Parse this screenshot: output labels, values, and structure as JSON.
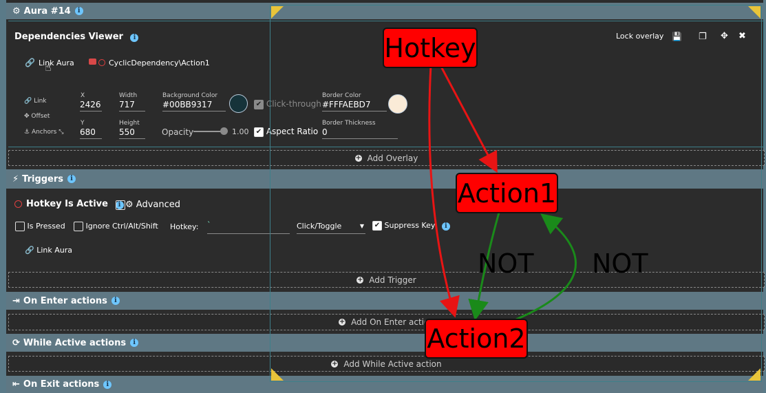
{
  "aura_header": {
    "title": "Aura #14"
  },
  "dependencies": {
    "title": "Dependencies Viewer",
    "lock_overlay": "Lock overlay"
  },
  "link_row": {
    "link_aura": "Link Aura",
    "path": "CyclicDependency\\Action1"
  },
  "props": {
    "side_link": "Link",
    "side_offset": "Offset",
    "side_anchors": "Anchors",
    "x_label": "X",
    "x_value": "2426",
    "y_label": "Y",
    "y_value": "680",
    "width_label": "Width",
    "width_value": "717",
    "height_label": "Height",
    "height_value": "550",
    "bg_color_label": "Background Color",
    "bg_color_value": "#00BB9317",
    "click_through": "Click-through",
    "opacity_label": "Opacity",
    "opacity_value": "1.00",
    "opacity_fraction": 1.0,
    "aspect_ratio": "Aspect Ratio",
    "border_color_label": "Border Color",
    "border_color_value": "#FFFAEBD7",
    "border_thickness_label": "Border Thickness",
    "border_thickness_value": "0"
  },
  "add_overlay": "Add Overlay",
  "triggers": {
    "title": "Triggers",
    "hotkey_active": "Hotkey Is Active",
    "advanced": "Advanced",
    "is_pressed": "Is Pressed",
    "ignore": "Ignore Ctrl/Alt/Shift",
    "hotkey_label": "Hotkey:",
    "hotkey_value": "`",
    "mode": "Click/Toggle",
    "suppress": "Suppress Key",
    "link_aura": "Link Aura",
    "add_trigger": "Add Trigger"
  },
  "on_enter": {
    "title": "On Enter actions",
    "add": "Add On Enter action"
  },
  "while_active": {
    "title": "While Active actions",
    "add": "Add While Active action"
  },
  "on_exit": {
    "title": "On Exit actions"
  },
  "graph": {
    "nodes": [
      "Hotkey",
      "Action1",
      "Action2"
    ],
    "edge_labels": [
      "NOT",
      "NOT"
    ]
  },
  "colors": {
    "header": "#5f7884",
    "accent_info": "#6ec6ff",
    "node_fill": "#ff0000",
    "edge_red": "#e81414",
    "edge_green": "#1a8a1a",
    "overlay_border": "#3e7f8a"
  },
  "icons": [
    "gear-icon",
    "info-icon",
    "link-icon",
    "image-icon",
    "save-icon",
    "copy-icon",
    "move-icon",
    "close-icon",
    "bolt-icon",
    "sign-in-icon",
    "refresh-icon",
    "sign-out-icon",
    "plus-circle-icon"
  ]
}
